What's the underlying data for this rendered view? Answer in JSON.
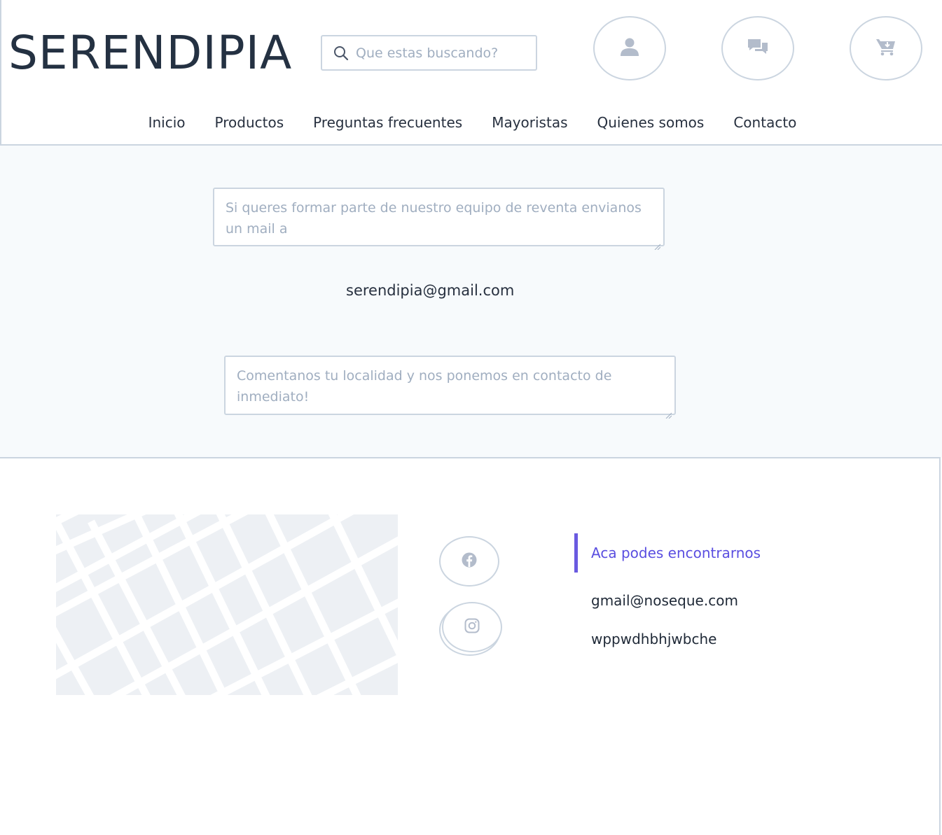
{
  "header": {
    "logo": "SERENDIPIA",
    "search_placeholder": "Que estas buscando?",
    "icons": [
      "user-icon",
      "chat-icon",
      "cart-icon"
    ]
  },
  "nav": {
    "items": [
      "Inicio",
      "Productos",
      "Preguntas frecuentes",
      "Mayoristas",
      "Quienes somos",
      "Contacto"
    ]
  },
  "main": {
    "textarea1_placeholder": "Si queres formar parte de nuestro equipo de reventa envianos un mail a",
    "email": "serendipia@gmail.com",
    "textarea2_placeholder": "Comentanos tu localidad y nos ponemos en contacto de inmediato!"
  },
  "footer": {
    "social_icons": [
      "facebook-icon",
      "instagram-icon"
    ],
    "contact_title": "Aca podes encontrarnos",
    "contact_email": "gmail@noseque.com",
    "contact_other": "wppwdhbhjwbche"
  },
  "colors": {
    "accent": "#6a5ae0",
    "border": "#cbd5e0",
    "text": "#27303f",
    "muted": "#a0aec0",
    "background_main": "#f7fafc"
  }
}
